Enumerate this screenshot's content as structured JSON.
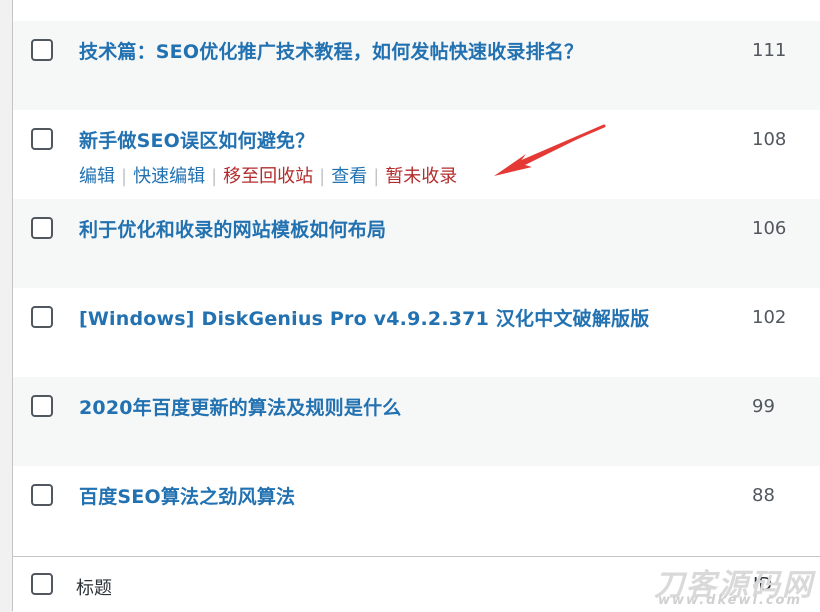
{
  "rows": [
    {
      "title": "技术篇：SEO优化推广技术教程，如何发帖快速收录排名？",
      "id": "111"
    },
    {
      "title": "新手做SEO误区如何避免？",
      "id": "108"
    },
    {
      "title": "利于优化和收录的网站模板如何布局",
      "id": "106"
    },
    {
      "title": "[Windows] DiskGenius Pro v4.9.2.371 汉化中文破解版版",
      "id": "102"
    },
    {
      "title": "2020年百度更新的算法及规则是什么",
      "id": "99"
    },
    {
      "title": "百度SEO算法之劲风算法",
      "id": "88"
    }
  ],
  "row_actions": {
    "edit": "编辑",
    "quick_edit": "快速编辑",
    "trash": "移至回收站",
    "view": "查看",
    "not_indexed": "暂未收录",
    "separator": "|"
  },
  "footer": {
    "title_label": "标题",
    "id_label": "ID"
  },
  "watermark": {
    "line1": "刀客源码网",
    "line2": "www.dkewl.com"
  },
  "colors": {
    "link": "#2271b1",
    "danger": "#b32d2e",
    "arrow": "#e53935"
  }
}
